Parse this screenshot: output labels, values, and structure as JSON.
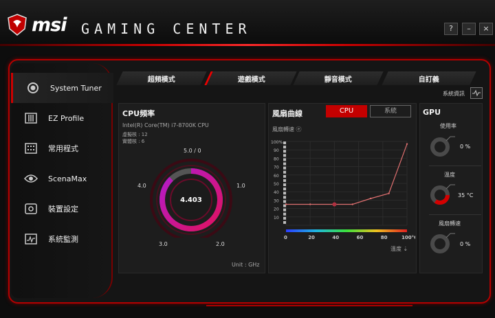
{
  "app": {
    "brand": "msi",
    "title": "GAMING CENTER"
  },
  "window_controls": {
    "help": "?",
    "minimize": "–",
    "close": "×"
  },
  "sidebar": {
    "items": [
      {
        "label": "System Tuner",
        "icon": "system-tuner-icon",
        "active": true
      },
      {
        "label": "EZ Profile",
        "icon": "ez-profile-icon"
      },
      {
        "label": "常用程式",
        "icon": "apps-grid-icon"
      },
      {
        "label": "ScenaMax",
        "icon": "eye-icon"
      },
      {
        "label": "裝置設定",
        "icon": "device-settings-icon"
      },
      {
        "label": "系統監測",
        "icon": "system-monitor-icon"
      }
    ]
  },
  "tabs": [
    {
      "label": "超頻模式"
    },
    {
      "label": "遊戲模式",
      "active": true
    },
    {
      "label": "靜音模式"
    },
    {
      "label": "自訂義"
    }
  ],
  "system_info": "系統資訊",
  "cpu": {
    "title": "CPU頻率",
    "model": "Intel(R) Core(TM) i7-8700K CPU",
    "logical_cores": "虛擬核 : 12",
    "physical_cores": "實體核 : 6",
    "value": "4.403",
    "ticks": [
      "5.0 / 0",
      "1.0",
      "2.0",
      "3.0",
      "4.0"
    ],
    "unit": "Unit : GHz",
    "gauge_fraction": 0.88
  },
  "fan": {
    "title": "風扇曲線",
    "btn_cpu": "CPU",
    "btn_system": "系統",
    "ylabel": "風扇轉速 ⓔ",
    "xlabel": "溫度 ⇣",
    "y_ticks": [
      "100%",
      "90",
      "80",
      "70",
      "60",
      "50",
      "40",
      "30",
      "20",
      "10"
    ],
    "x_ticks": [
      "0",
      "20",
      "40",
      "60",
      "80",
      "100°C"
    ]
  },
  "chart_data": {
    "type": "line",
    "x": [
      0,
      20,
      40,
      55,
      70,
      85,
      100
    ],
    "y": [
      25,
      25,
      25,
      25,
      32,
      38,
      97
    ],
    "xlabel": "溫度",
    "ylabel": "風扇轉速",
    "xlim": [
      0,
      100
    ],
    "ylim": [
      0,
      100
    ]
  },
  "gpu": {
    "title": "GPU",
    "usage_label": "使用率",
    "usage_value": "0 %",
    "usage_fraction": 0,
    "temp_label": "溫度",
    "temp_value": "35 °C",
    "temp_fraction": 0.35,
    "fan_label": "風扇轉速",
    "fan_value": "0 %",
    "fan_fraction": 0
  },
  "colors": {
    "accent": "#c40000",
    "gauge_purple": "#8e1fa6",
    "gauge_pink": "#e0125f"
  }
}
